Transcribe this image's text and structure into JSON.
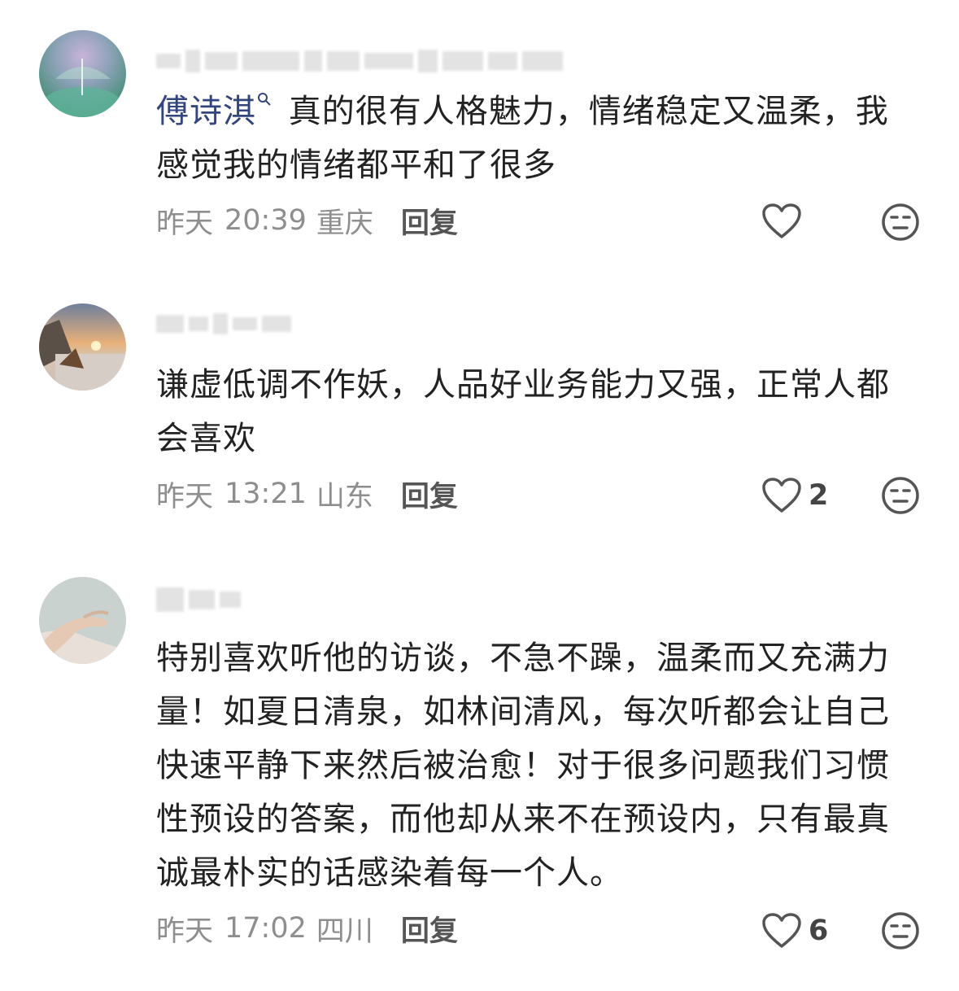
{
  "comments": [
    {
      "mention": "傅诗淇",
      "text": " 真的很有人格魅力，情绪稳定又温柔，我感觉我的情绪都平和了很多",
      "date": "昨天",
      "time": "20:39",
      "location": "重庆",
      "reply_label": "回复",
      "likes": ""
    },
    {
      "mention": "",
      "text": "谦虚低调不作妖，人品好业务能力又强，正常人都会喜欢",
      "date": "昨天",
      "time": "13:21",
      "location": "山东",
      "reply_label": "回复",
      "likes": "2"
    },
    {
      "mention": "",
      "text": "特别喜欢听他的访谈，不急不躁，温柔而又充满力量！如夏日清泉，如林间清风，每次听都会让自己快速平静下来然后被治愈！对于很多问题我们习惯性预设的答案，而他却从来不在预设内，只有最真诚最朴实的话感染着每一个人。",
      "date": "昨天",
      "time": "17:02",
      "location": "四川",
      "reply_label": "回复",
      "likes": "6"
    }
  ],
  "icons": {
    "like": "heart-outline-icon",
    "dislike": "meh-face-icon",
    "mention": "search-magnifier-icon"
  },
  "colors": {
    "mention": "#32457c",
    "body": "#222222",
    "meta": "#8e8e8e",
    "icon": "#555555"
  }
}
